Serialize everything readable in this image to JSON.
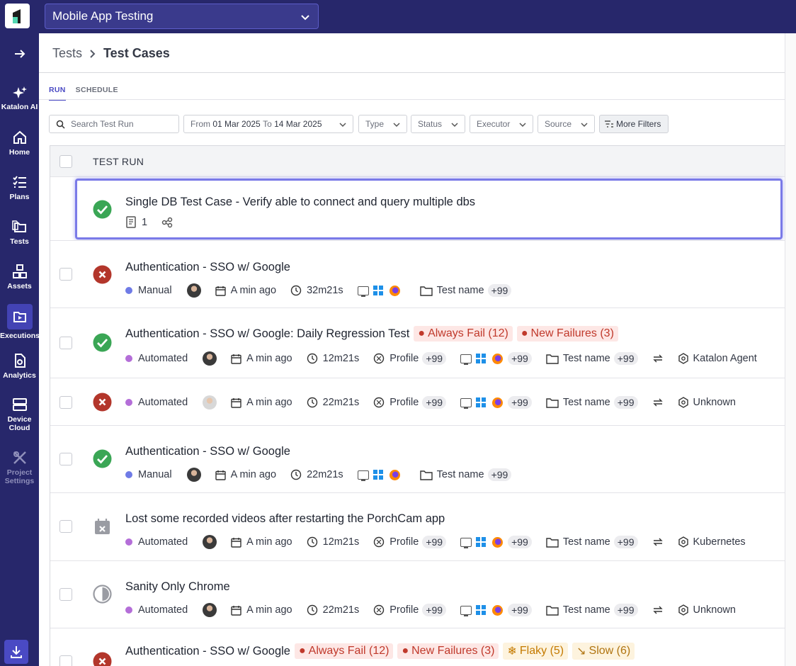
{
  "project": {
    "name": "Mobile App Testing"
  },
  "sidebar": {
    "items": [
      {
        "label": "Katalon AI",
        "icon": "sparkle-icon"
      },
      {
        "label": "Home",
        "icon": "home-icon"
      },
      {
        "label": "Plans",
        "icon": "checklist-icon"
      },
      {
        "label": "Tests",
        "icon": "folders-icon"
      },
      {
        "label": "Assets",
        "icon": "assets-icon"
      },
      {
        "label": "Executions",
        "icon": "executions-icon"
      },
      {
        "label": "Analytics",
        "icon": "analytics-icon"
      },
      {
        "label": "Device Cloud",
        "icon": "device-cloud-icon"
      },
      {
        "label": "Project Settings",
        "icon": "tools-icon"
      }
    ]
  },
  "breadcrumb": {
    "parent": "Tests",
    "current": "Test Cases"
  },
  "tabs": [
    "RUN",
    "SCHEDULE"
  ],
  "filters": {
    "search_placeholder": "Search Test Run",
    "date_from_label": "From",
    "date_from": "01 Mar 2025",
    "date_to_label": "To",
    "date_to": "14 Mar 2025",
    "type": "Type",
    "status": "Status",
    "executor": "Executor",
    "source": "Source",
    "more": "More Filters"
  },
  "table": {
    "header": "TEST RUN",
    "rows": [
      {
        "status": "passed",
        "title": "Single DB Test Case - Verify able to connect and query multiple dbs",
        "steps": "1"
      },
      {
        "status": "failed",
        "title": "Authentication - SSO w/ Google",
        "type": "Manual",
        "time": "A min ago",
        "duration": "32m21s",
        "env_more": "",
        "testname": "Test name",
        "testname_more": "+99"
      },
      {
        "status": "passed",
        "title": "Authentication - SSO w/ Google: Daily Regression Test",
        "tags": [
          "Always Fail (12)",
          "New Failures (3)"
        ],
        "type": "Automated",
        "time": "A min ago",
        "duration": "12m21s",
        "profile": "Profile",
        "profile_more": "+99",
        "env_more": "+99",
        "testname": "Test name",
        "testname_more": "+99",
        "agent": "Katalon Agent"
      },
      {
        "status": "failed",
        "title": "",
        "type": "Automated",
        "time": "A min ago",
        "duration": "22m21s",
        "profile": "Profile",
        "profile_more": "+99",
        "env_more": "+99",
        "testname": "Test name",
        "testname_more": "+99",
        "agent": "Unknown"
      },
      {
        "status": "passed",
        "title": "Authentication - SSO w/ Google",
        "type": "Manual",
        "time": "A min ago",
        "duration": "22m21s",
        "testname": "Test name",
        "testname_more": "+99"
      },
      {
        "status": "canceled",
        "title": "Lost some recorded videos after restarting the PorchCam app",
        "type": "Automated",
        "time": "A min ago",
        "duration": "12m21s",
        "profile": "Profile",
        "profile_more": "+99",
        "env_more": "+99",
        "testname": "Test name",
        "testname_more": "+99",
        "agent": "Kubernetes"
      },
      {
        "status": "incomplete",
        "title": "Sanity Only Chrome",
        "type": "Automated",
        "time": "A min ago",
        "duration": "22m21s",
        "profile": "Profile",
        "profile_more": "+99",
        "env_more": "+99",
        "testname": "Test name",
        "testname_more": "+99",
        "agent": "Unknown"
      },
      {
        "status": "failed",
        "title": "Authentication - SSO w/ Google",
        "tags": [
          "Always Fail (12)",
          "New Failures (3)",
          "Flaky (5)",
          "Slow (6)"
        ]
      }
    ]
  },
  "colors": {
    "brand": "#27276b",
    "accent": "#4a4ac4",
    "passed": "#3aa655",
    "failed": "#b3362b"
  }
}
